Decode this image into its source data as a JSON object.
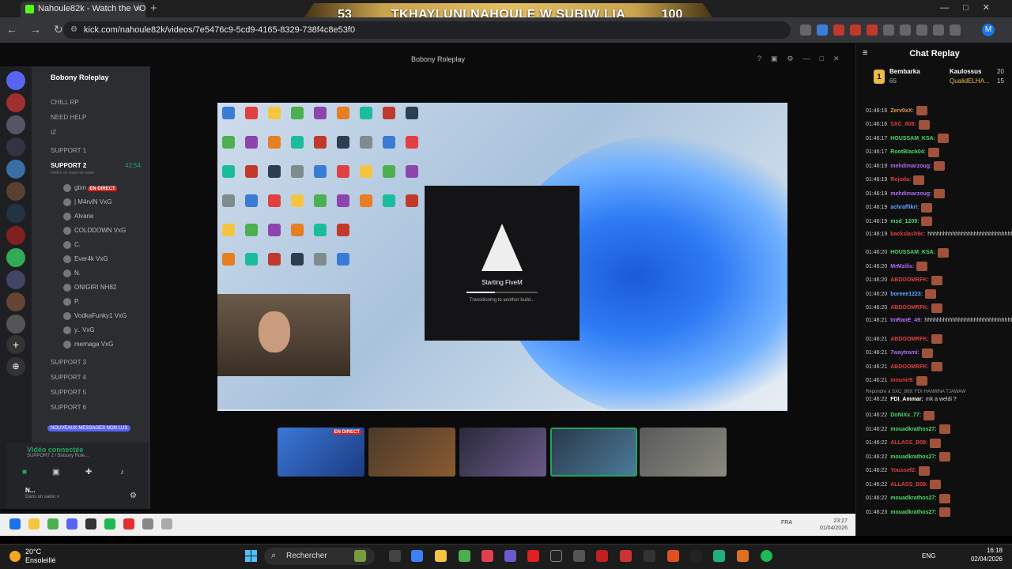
{
  "browser": {
    "tab_title": "Nahoule82k - Watch the VO",
    "url": "kick.com/nahoule82k/videos/7e5476c9-5cd9-4165-8329-738f4c8e53f0",
    "profile_initial": "M"
  },
  "banner": {
    "left_score": "53",
    "title": "TKHAYLUNI NAHOULE W SUBIW LIA",
    "right_score": "100"
  },
  "discord": {
    "window_title": "Bobony Roleplay",
    "server_name": "Bobony Roleplay",
    "channels": [
      {
        "label": "CHILL RP",
        "badge": "1"
      },
      {
        "label": "NEED HELP",
        "badge": "10"
      },
      {
        "label": "IZ"
      },
      {
        "label": "SUPPORT 1",
        "badge": "00 99"
      },
      {
        "label": "SUPPORT 2",
        "timer": "42:54",
        "active": true
      },
      {
        "label": "SUPPORT 3"
      },
      {
        "label": "SUPPORT 4"
      },
      {
        "label": "SUPPORT 5"
      },
      {
        "label": "SUPPORT 6"
      },
      {
        "label": "SUPPORT 7"
      }
    ],
    "status_hint": "Définir un statut de salon",
    "live_badge": "EN DIRECT",
    "users": [
      {
        "name": "gtxn",
        "live": true
      },
      {
        "name": "| M4rviN",
        "tag": "VxG"
      },
      {
        "name": "Alvarie"
      },
      {
        "name": "COLDDOWN",
        "tag": "VxG"
      },
      {
        "name": "C."
      },
      {
        "name": "Ever4k",
        "tag": "VxG"
      },
      {
        "name": "N."
      },
      {
        "name": "ONIGIRI",
        "tag": "NH82"
      },
      {
        "name": "P."
      },
      {
        "name": "VodkaFunky1",
        "tag": "VxG"
      },
      {
        "name": "y..",
        "tag": "VxG"
      },
      {
        "name": "mernaga",
        "tag": "VxG"
      }
    ],
    "new_messages": "NOUVEAUX MESSAGES NON LUS",
    "voice_connected": "Vidéo connectée",
    "voice_sub": "SUPPORT 2 / Bobony Role...",
    "me_name": "N...",
    "me_status": "Dans un salon v",
    "rail_badges": [
      "906",
      "1K+",
      "129",
      "1K+",
      "1K+",
      "119",
      "24",
      "2K+"
    ]
  },
  "fivem": {
    "title": "Starting FiveM",
    "subtitle": "Transitioning to another build...",
    "progress": 0.4
  },
  "tiles": {
    "live_badge": "EN DIRECT"
  },
  "inner_taskbar": {
    "lang": "FRA",
    "time": "23:27",
    "date": "01/04/2026"
  },
  "chat": {
    "title": "Chat Replay",
    "leaderboard": [
      {
        "name": "Bembarka",
        "count": "65"
      },
      {
        "name": "Kaulossus",
        "count": "20"
      },
      {
        "name": "QualidELHA...",
        "count": "15"
      }
    ],
    "messages": [
      {
        "time": "01:46:16",
        "user": "Zerv0xX:",
        "color": "#e0a050",
        "text": ""
      },
      {
        "time": "01:46:16",
        "user": "SXC_808:",
        "color": "#e04040",
        "text": ""
      },
      {
        "time": "01:46:17",
        "user": "HOUSSAM_KSA:",
        "color": "#4cd964",
        "text": ""
      },
      {
        "time": "01:46:17",
        "user": "RootBlack04:",
        "color": "#4cd964",
        "text": ""
      },
      {
        "time": "01:46:19",
        "user": "mehdimarzoug:",
        "color": "#b06cf5",
        "text": ""
      },
      {
        "time": "01:46:19",
        "user": "Rojuda:",
        "color": "#e04040",
        "text": ""
      },
      {
        "time": "01:46:19",
        "user": "mehdimarzoug:",
        "color": "#b06cf5",
        "text": ""
      },
      {
        "time": "01:46:19",
        "user": "achraffikri:",
        "color": "#5fa8ff",
        "text": ""
      },
      {
        "time": "01:46:19",
        "user": "msd_1209:",
        "color": "#4cd964",
        "text": ""
      },
      {
        "time": "01:46:19",
        "user": "backslash9c:",
        "color": "#e04040",
        "text": "hhhhhhhhhhhhhhhhhhhhhhhhhhhhhhhhhhhhhhhhhhhhhhhhhhhhhhhhhh",
        "wrap": true
      },
      {
        "time": "01:46:20",
        "user": "HOUSSAM_KSA:",
        "color": "#4cd964",
        "text": ""
      },
      {
        "time": "01:46:20",
        "user": "MrMzilis:",
        "color": "#b06cf5",
        "text": ""
      },
      {
        "time": "01:46:20",
        "user": "ABDOOMRFK:",
        "color": "#e04040",
        "text": ""
      },
      {
        "time": "01:46:20",
        "user": "boreee1223:",
        "color": "#5fa8ff",
        "text": ""
      },
      {
        "time": "01:46:20",
        "user": "ABDOOMRFK:",
        "color": "#e04040",
        "text": ""
      },
      {
        "time": "01:46:21",
        "user": "ImRanE_49:",
        "color": "#b06cf5",
        "text": "hhhhhhhhhhhhhhhhhhhhhhhhhhhhhhhhhhhhhh",
        "wrap": true
      },
      {
        "time": "01:46:21",
        "user": "ABDOOMRFK:",
        "color": "#e04040",
        "text": ""
      },
      {
        "time": "01:46:21",
        "user": "7waytrami:",
        "color": "#b06cf5",
        "text": ""
      },
      {
        "time": "01:46:21",
        "user": "ABDOOMRFK:",
        "color": "#e04040",
        "text": ""
      },
      {
        "time": "01:46:21",
        "user": "mounir9:",
        "color": "#e04040",
        "text": ""
      },
      {
        "time": "01:46:22",
        "user": "FDI_Ammar:",
        "color": "#ffffff",
        "text": "mk a weldi ?",
        "reply": "Répondre à SXC_808: FDI HANWNA TJAWAW"
      },
      {
        "time": "01:46:22",
        "user": "DoNiXx_77:",
        "color": "#4cd964",
        "text": ""
      },
      {
        "time": "01:46:22",
        "user": "mouadkrathos27:",
        "color": "#4cd964",
        "text": ""
      },
      {
        "time": "01:46:22",
        "user": "ALLASS_B08:",
        "color": "#e04040",
        "text": ""
      },
      {
        "time": "01:46:22",
        "user": "mouadkrathos27:",
        "color": "#4cd964",
        "text": ""
      },
      {
        "time": "01:46:22",
        "user": "Youssef2:",
        "color": "#e04040",
        "text": ""
      },
      {
        "time": "01:46:22",
        "user": "ALLASS_B08:",
        "color": "#e04040",
        "text": ""
      },
      {
        "time": "01:46:22",
        "user": "mouadkrathos27:",
        "color": "#4cd964",
        "text": ""
      },
      {
        "time": "01:46:23",
        "user": "mouadkrathos27:",
        "color": "#4cd964",
        "text": ""
      }
    ]
  },
  "os": {
    "temp": "20°C",
    "weather": "Ensoleillé",
    "search": "Rechercher",
    "lang": "ENG",
    "time": "16:18",
    "date": "02/04/2026"
  }
}
